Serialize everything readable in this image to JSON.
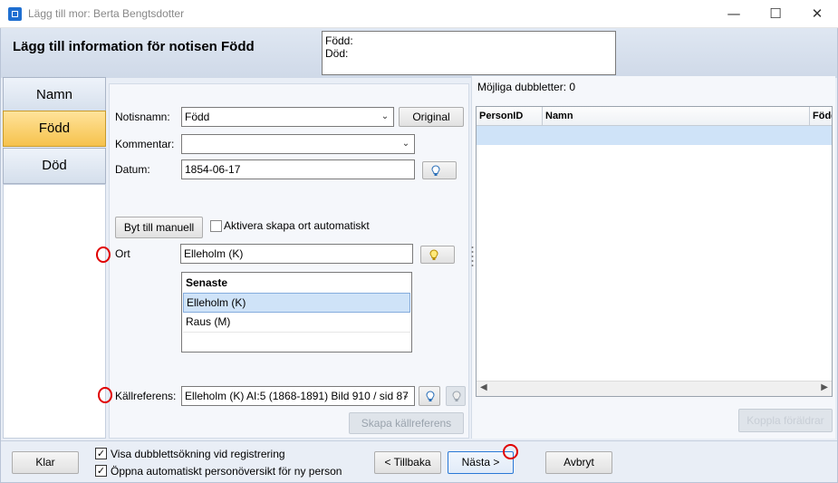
{
  "window": {
    "title": "Lägg till mor: Berta Bengtsdotter",
    "minimize_glyph": "—",
    "maximize_glyph": "☐",
    "close_glyph": "✕"
  },
  "header": {
    "title": "Lägg till information för notisen Född",
    "summary_line1": "Född:",
    "summary_line2": "Död:"
  },
  "nav": {
    "items": [
      {
        "label": "Namn",
        "active": false
      },
      {
        "label": "Född",
        "active": true
      },
      {
        "label": "Död",
        "active": false
      }
    ]
  },
  "form": {
    "notisnamn_label": "Notisnamn:",
    "notisnamn_value": "Född",
    "original_button": "Original",
    "kommentar_label": "Kommentar:",
    "kommentar_value": "",
    "datum_label": "Datum:",
    "datum_value": "1854-06-17",
    "byt_button": "Byt till manuell",
    "aktivera_label": "Aktivera skapa ort automatiskt",
    "ort_label": "Ort",
    "ort_value": "Elleholm (K)",
    "senaste_header": "Senaste",
    "senaste_items": [
      "Elleholm (K)",
      "Raus (M)"
    ],
    "kallreferens_label": "Källreferens:",
    "kallreferens_value": "Elleholm (K) AI:5 (1868-1891) Bild 910 / sid 87",
    "skapa_button": "Skapa källreferens"
  },
  "duplicates": {
    "title": "Möjliga dubbletter: 0",
    "columns": [
      "PersonID",
      "Namn",
      "Född"
    ],
    "koppla_button": "Koppla föräldrar"
  },
  "bottom": {
    "klar_button": "Klar",
    "visa_label": "Visa dubblettsökning vid registrering",
    "oppna_label": "Öppna automatiskt personöversikt för ny person",
    "tillbaka_button": "< Tillbaka",
    "nasta_button": "Nästa >",
    "avbryt_button": "Avbryt",
    "check_glyph": "✓"
  },
  "colors": {
    "accent": "#2a78d6",
    "active_tab": "#f6c24d",
    "marker": "#e00000"
  }
}
